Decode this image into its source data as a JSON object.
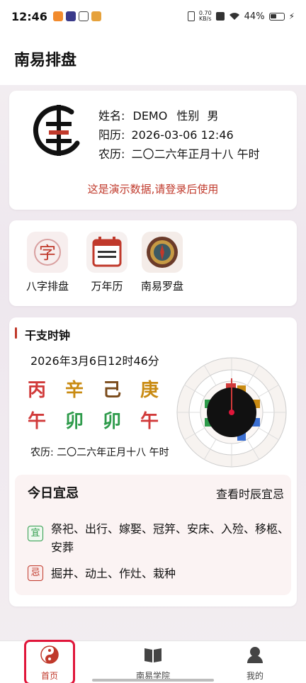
{
  "status_bar": {
    "time": "12:46",
    "net_speed": "0.70\nKB/s",
    "battery": "44%"
  },
  "header": {
    "title": "南易排盘"
  },
  "profile": {
    "name_label": "姓名:",
    "name": "DEMO",
    "gender_label": "性别",
    "gender": "男",
    "solar_label": "阳历:",
    "solar": "2026-03-06 12:46",
    "lunar_label": "农历:",
    "lunar": "二〇二六年正月十八 午时",
    "notice": "这是演示数据,请登录后使用"
  },
  "tools": [
    {
      "label": "八字排盘",
      "icon": "bazi-icon"
    },
    {
      "label": "万年历",
      "icon": "calendar-icon"
    },
    {
      "label": "南易罗盘",
      "icon": "compass-icon"
    }
  ],
  "clock": {
    "section_title": "干支时钟",
    "datetime": "2026年3月6日12时46分",
    "stems": [
      "丙",
      "辛",
      "己",
      "庚"
    ],
    "branches": [
      "午",
      "卯",
      "卯",
      "午"
    ],
    "lunar": "农历: 二〇二六年正月十八 午时",
    "colors": {
      "fire": "#d13a3a",
      "metal": "#c98b12",
      "earth": "#7a4a1a",
      "wood": "#2e9b4b"
    }
  },
  "yiji": {
    "title": "今日宜忌",
    "link": "查看时辰宜忌",
    "yi_badge": "宜",
    "ji_badge": "忌",
    "yi": "祭祀、出行、嫁娶、冠笄、安床、入殓、移柩、安葬",
    "ji": "掘井、动土、作灶、栽种"
  },
  "nav": {
    "items": [
      {
        "label": "首页",
        "icon": "yin-yang-icon",
        "active": true
      },
      {
        "label": "南易学院",
        "icon": "book-icon",
        "active": false
      },
      {
        "label": "我的",
        "icon": "user-icon",
        "active": false
      }
    ]
  }
}
